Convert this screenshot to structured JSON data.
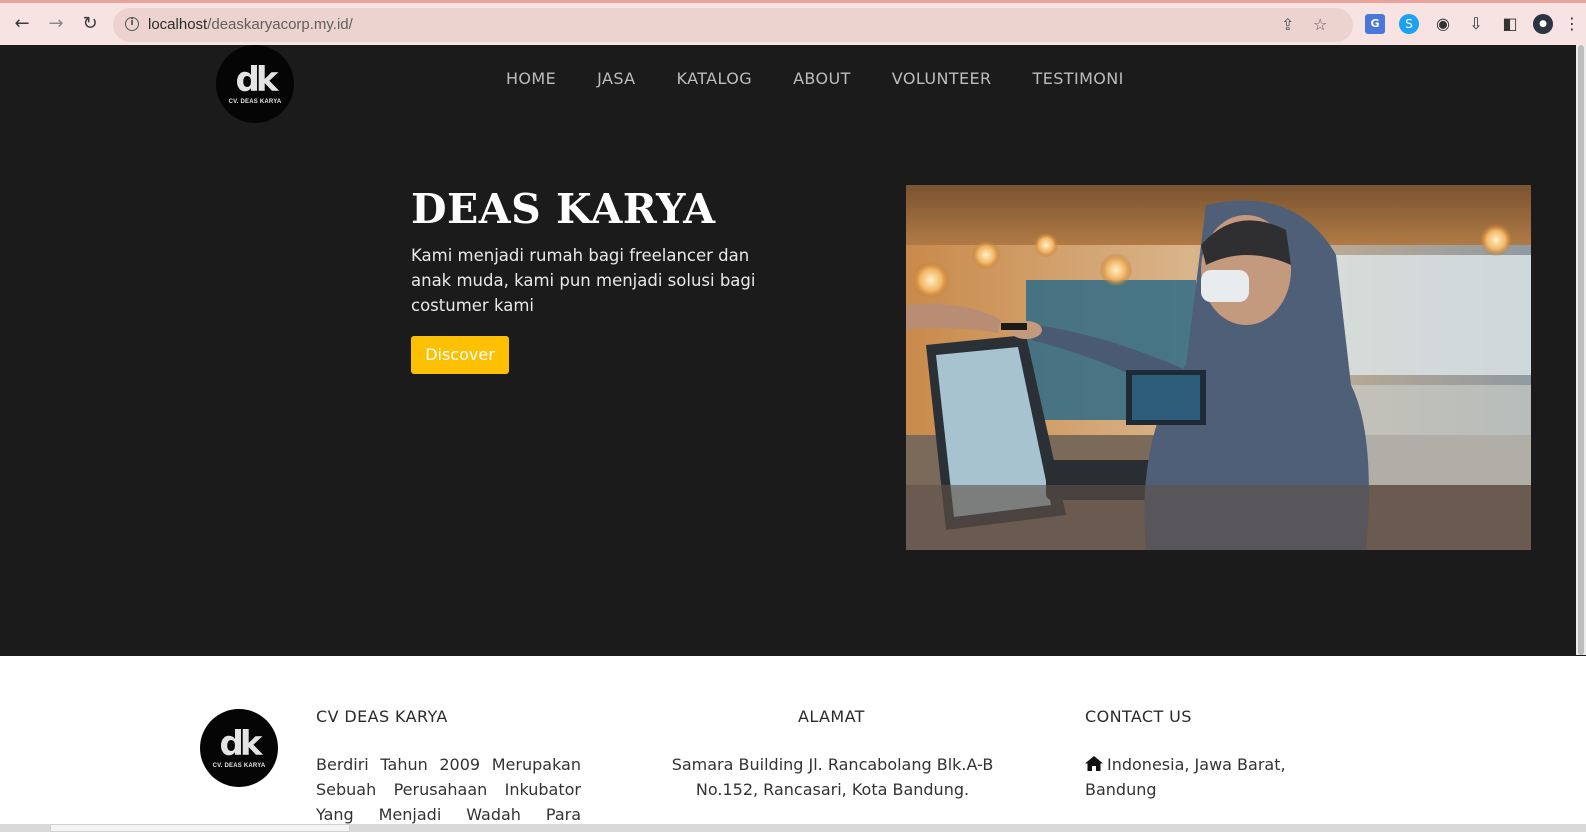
{
  "browser": {
    "url_host": "localhost",
    "url_path": "/deaskaryacorp.my.id/",
    "back_icon": "arrow-left-icon",
    "forward_icon": "arrow-right-icon",
    "reload_icon": "reload-icon",
    "info_icon": "info-icon",
    "share_icon": "share-icon",
    "bookmark_icon": "star-icon",
    "extensions": [
      "translate-icon",
      "sync-icon",
      "puzzle-icon",
      "download-icon",
      "sidepanel-icon",
      "profile-icon",
      "menu-icon"
    ]
  },
  "site": {
    "logo_mono": "dk",
    "logo_caption": "CV. DEAS KARYA",
    "nav": [
      "HOME",
      "JASA",
      "KATALOG",
      "ABOUT",
      "VOLUNTEER",
      "TESTIMONI"
    ]
  },
  "hero": {
    "title": "DEAS KARYA",
    "text": "Kami menjadi rumah bagi freelancer dan anak muda, kami pun menjadi solusi bagi costumer kami",
    "button": "Discover"
  },
  "footer": {
    "company_title": "CV DEAS KARYA",
    "company_text": "Berdiri Tahun 2009 Merupakan Sebuah Perusahaan Inkubator Yang Menjadi Wadah Para",
    "address_title": "ALAMAT",
    "address_line1": "Samara Building Jl. Rancabolang Blk.A-B",
    "address_line2": "No.152, Rancasari, Kota Bandung.",
    "contact_title": "CONTACT US",
    "contact_location": "Indonesia, Jawa Barat, Bandung"
  }
}
